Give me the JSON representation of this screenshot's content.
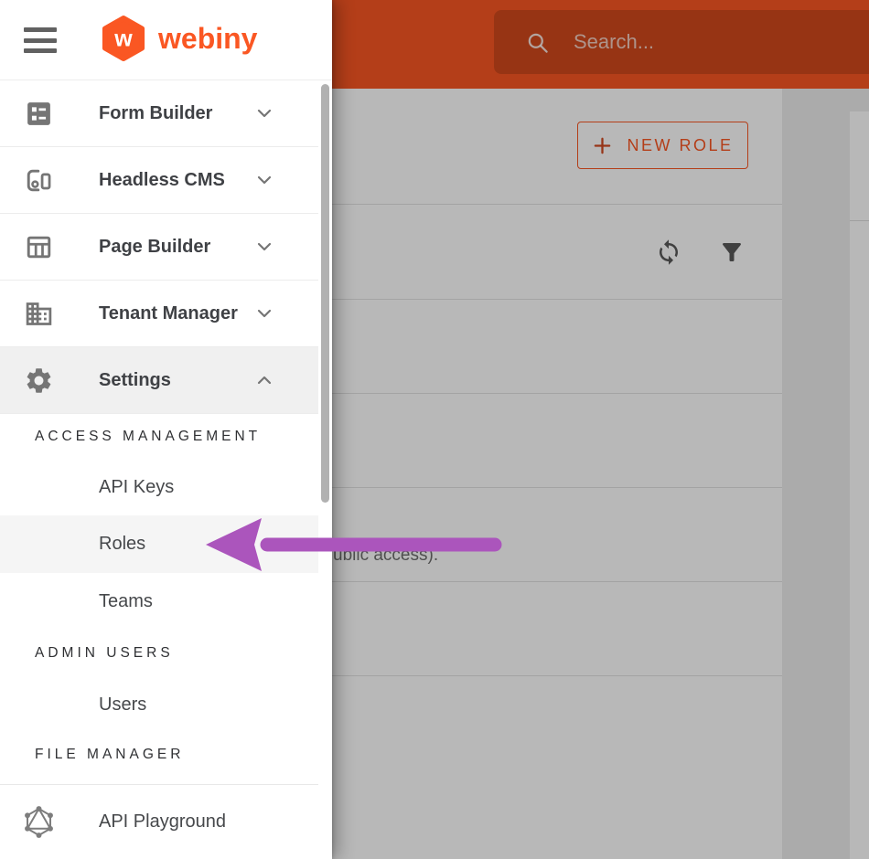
{
  "brand": {
    "name": "webiny",
    "logo_letter": "w",
    "accent_color": "#fa5723"
  },
  "topbar": {
    "search": {
      "placeholder": "Search...",
      "icon": "search-icon"
    }
  },
  "sidebar": {
    "items": [
      {
        "type": "group",
        "label": "Form Builder",
        "icon": "form-builder-icon",
        "state": "collapsed"
      },
      {
        "type": "group",
        "label": "Headless CMS",
        "icon": "headless-cms-icon",
        "state": "collapsed"
      },
      {
        "type": "group",
        "label": "Page Builder",
        "icon": "page-builder-icon",
        "state": "collapsed"
      },
      {
        "type": "group",
        "label": "Tenant Manager",
        "icon": "tenant-manager-icon",
        "state": "collapsed"
      },
      {
        "type": "group",
        "label": "Settings",
        "icon": "settings-icon",
        "state": "expanded"
      },
      {
        "type": "section",
        "label": "ACCESS MANAGEMENT"
      },
      {
        "type": "link",
        "label": "API Keys"
      },
      {
        "type": "link",
        "label": "Roles",
        "highlighted": true
      },
      {
        "type": "link",
        "label": "Teams"
      },
      {
        "type": "section",
        "label": "ADMIN USERS"
      },
      {
        "type": "link",
        "label": "Users"
      },
      {
        "type": "section",
        "label": "FILE MANAGER"
      }
    ],
    "footer": {
      "label": "API Playground",
      "icon": "graphql-icon"
    }
  },
  "content": {
    "new_role_button": {
      "label": "NEW ROLE",
      "icon": "plus-icon"
    },
    "toolbar_icons": [
      "refresh-icon",
      "filter-icon"
    ],
    "visible_row_text_fragment": "ublic access).",
    "annotation_arrow": {
      "color": "#ab55bc",
      "points_to": "Roles menu item"
    }
  }
}
